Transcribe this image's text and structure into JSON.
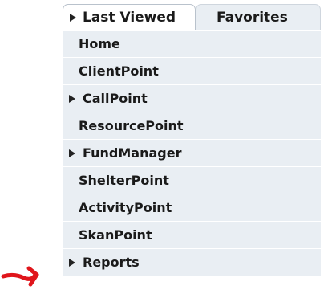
{
  "tabs": [
    {
      "label": "Last Viewed",
      "expanded_icon": "triangle-right-icon",
      "active": true
    },
    {
      "label": "Favorites",
      "active": false
    }
  ],
  "menu": {
    "items": [
      {
        "label": "Home",
        "has_children": false
      },
      {
        "label": "ClientPoint",
        "has_children": false
      },
      {
        "label": "CallPoint",
        "has_children": true
      },
      {
        "label": "ResourcePoint",
        "has_children": false
      },
      {
        "label": "FundManager",
        "has_children": true
      },
      {
        "label": "ShelterPoint",
        "has_children": false
      },
      {
        "label": "ActivityPoint",
        "has_children": false
      },
      {
        "label": "SkanPoint",
        "has_children": false
      },
      {
        "label": "Reports",
        "has_children": true
      }
    ]
  },
  "annotation": {
    "icon": "red-arrow-icon",
    "color": "#e0151b",
    "target_item": "Reports"
  },
  "colors": {
    "menu_background": "#e9eef3",
    "tab_border": "#b9c2cc",
    "text": "#1a1a1a"
  }
}
